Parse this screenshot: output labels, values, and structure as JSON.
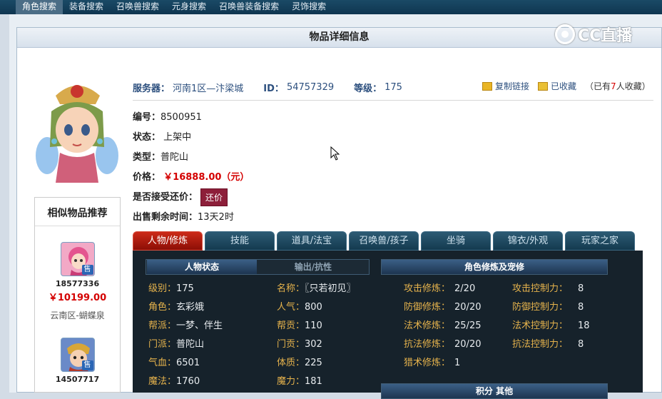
{
  "nav": {
    "items": [
      {
        "label": "角色搜索",
        "active": true
      },
      {
        "label": "装备搜索",
        "active": false
      },
      {
        "label": "召唤兽搜索",
        "active": false
      },
      {
        "label": "元身搜索",
        "active": false
      },
      {
        "label": "召唤兽装备搜索",
        "active": false
      },
      {
        "label": "灵饰搜索",
        "active": false
      }
    ]
  },
  "panel": {
    "title": "物品详细信息"
  },
  "logo": {
    "text": "CC直播"
  },
  "info": {
    "server_label": "服务器：",
    "server_value": "河南1区—汴梁城",
    "id_label": "ID：",
    "id_value": "54757329",
    "level_label": "等级：",
    "level_value": "175",
    "copy_link": "复制链接",
    "favorited": "已收藏",
    "fav_prefix": "（已有",
    "fav_count": "7",
    "fav_suffix": "人收藏）"
  },
  "fields": {
    "serial_label": "编号：",
    "serial_value": "8500951",
    "status_label": "状态：",
    "status_value": "上架中",
    "type_label": "类型：",
    "type_value": "普陀山",
    "price_label": "价格：",
    "price_value": "￥16888.00（元）",
    "bargain_label": "是否接受还价：",
    "bargain_button": "还价",
    "time_label": "出售剩余时间：",
    "time_value": "13天2时"
  },
  "similar": {
    "title": "相似物品推荐",
    "items": [
      {
        "id": "18577336",
        "price": "￥10199.00",
        "server": "云南区-蝴蝶泉",
        "badge": "售"
      },
      {
        "id": "14507717",
        "price": "",
        "server": "",
        "badge": "售"
      }
    ]
  },
  "tabs": [
    {
      "label": "人物/修炼",
      "active": true
    },
    {
      "label": "技能",
      "active": false
    },
    {
      "label": "道具/法宝",
      "active": false
    },
    {
      "label": "召唤兽/孩子",
      "active": false
    },
    {
      "label": "坐骑",
      "active": false
    },
    {
      "label": "锦衣/外观",
      "active": false
    },
    {
      "label": "玩家之家",
      "active": false
    }
  ],
  "sections": {
    "status_tab": "人物状态",
    "output_tab": "输出/抗性",
    "cultivation": "角色修炼及宠修",
    "points": "积分 其他"
  },
  "stats": [
    {
      "label": "级别：",
      "value": "175"
    },
    {
      "label": "名称：",
      "value": "〖只若初见〗"
    },
    {
      "label": "角色：",
      "value": "玄彩娥"
    },
    {
      "label": "人气：",
      "value": "800"
    },
    {
      "label": "帮派：",
      "value": "一梦、伴生"
    },
    {
      "label": "帮贡：",
      "value": "110"
    },
    {
      "label": "门派：",
      "value": "普陀山"
    },
    {
      "label": "门贡：",
      "value": "302"
    },
    {
      "label": "气血：",
      "value": "6501"
    },
    {
      "label": "体质：",
      "value": "225"
    },
    {
      "label": "魔法：",
      "value": "1760"
    },
    {
      "label": "魔力：",
      "value": "181"
    }
  ],
  "cultivation": [
    {
      "label": "攻击修炼：",
      "value": "2/20"
    },
    {
      "label": "攻击控制力：",
      "value": "8"
    },
    {
      "label": "防御修炼：",
      "value": "20/20"
    },
    {
      "label": "防御控制力：",
      "value": "8"
    },
    {
      "label": "法术修炼：",
      "value": "25/25"
    },
    {
      "label": "法术控制力：",
      "value": "18"
    },
    {
      "label": "抗法修炼：",
      "value": "20/20"
    },
    {
      "label": "抗法控制力：",
      "value": "8"
    },
    {
      "label": "猎术修炼：",
      "value": "1"
    }
  ],
  "colors": {
    "price": "#d40000",
    "label_gold": "#e6b34c",
    "tab_active": "#cc2a18"
  }
}
